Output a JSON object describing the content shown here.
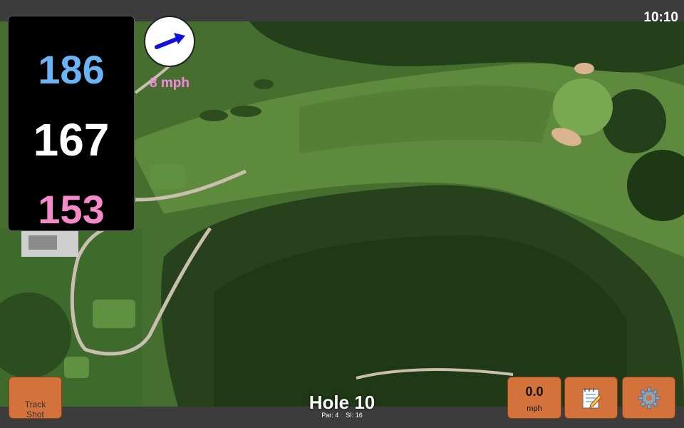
{
  "status_bar": {
    "time": "10:10"
  },
  "distances": {
    "back": "186",
    "middle": "167",
    "front": "153",
    "colors": {
      "back": "#6ab4f5",
      "middle": "#ffffff",
      "front": "#f58ac8"
    }
  },
  "wind": {
    "speed_label": "8 mph",
    "speed_color": "#f58ae0",
    "direction_icon": "wind-arrow-icon"
  },
  "buttons": {
    "track_shot": "Track\nShot",
    "speed_value": "0.0",
    "speed_unit": "mph",
    "notes_icon": "notepad-icon",
    "settings_icon": "gear-icon",
    "color": "#d4723c"
  },
  "hole": {
    "title": "Hole 10",
    "par": "Par: 4",
    "stroke_index": "SI: 16"
  }
}
